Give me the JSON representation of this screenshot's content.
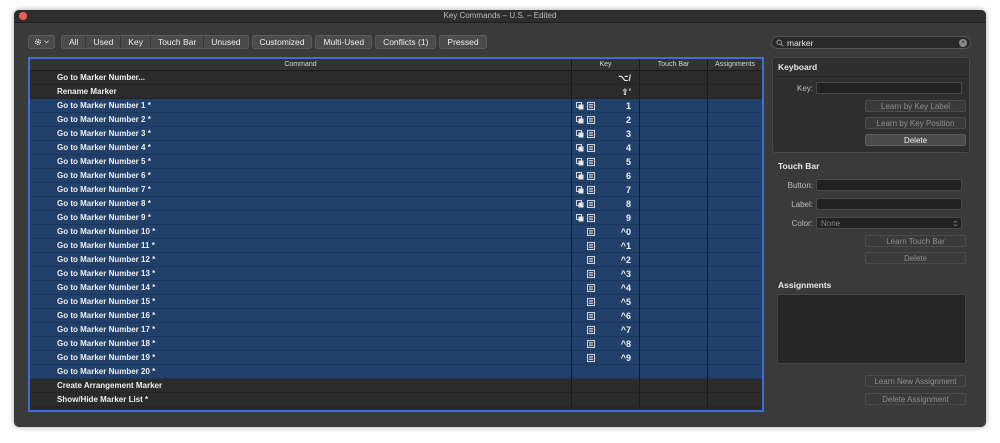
{
  "window": {
    "title": "Key Commands – U.S. – Edited"
  },
  "toolbar": {
    "filters": [
      "All",
      "Used",
      "Key",
      "Touch Bar",
      "Unused"
    ],
    "customized": "Customized",
    "multi_used": "Multi-Used",
    "conflicts": "Conflicts (1)",
    "pressed": "Pressed"
  },
  "search": {
    "value": "marker"
  },
  "table": {
    "headers": {
      "command": "Command",
      "key": "Key",
      "touch_bar": "Touch Bar",
      "assignments": "Assignments"
    },
    "rows": [
      {
        "command": "Go to Marker Number...",
        "key": "⌥/",
        "icons": false,
        "selected": false
      },
      {
        "command": "Rename Marker",
        "key": "⇧'",
        "icons": false,
        "selected": false
      },
      {
        "command": "Go to Marker Number 1 *",
        "key": "1",
        "icons": true,
        "selected": true
      },
      {
        "command": "Go to Marker Number 2 *",
        "key": "2",
        "icons": true,
        "selected": true
      },
      {
        "command": "Go to Marker Number 3 *",
        "key": "3",
        "icons": true,
        "selected": true
      },
      {
        "command": "Go to Marker Number 4 *",
        "key": "4",
        "icons": true,
        "selected": true
      },
      {
        "command": "Go to Marker Number 5 *",
        "key": "5",
        "icons": true,
        "selected": true
      },
      {
        "command": "Go to Marker Number 6 *",
        "key": "6",
        "icons": true,
        "selected": true
      },
      {
        "command": "Go to Marker Number 7 *",
        "key": "7",
        "icons": true,
        "selected": true
      },
      {
        "command": "Go to Marker Number 8 *",
        "key": "8",
        "icons": true,
        "selected": true
      },
      {
        "command": "Go to Marker Number 9 *",
        "key": "9",
        "icons": true,
        "selected": true
      },
      {
        "command": "Go to Marker Number 10 *",
        "key": "^0",
        "icons": "single",
        "selected": true
      },
      {
        "command": "Go to Marker Number 11 *",
        "key": "^1",
        "icons": "single",
        "selected": true
      },
      {
        "command": "Go to Marker Number 12 *",
        "key": "^2",
        "icons": "single",
        "selected": true
      },
      {
        "command": "Go to Marker Number 13 *",
        "key": "^3",
        "icons": "single",
        "selected": true
      },
      {
        "command": "Go to Marker Number 14 *",
        "key": "^4",
        "icons": "single",
        "selected": true
      },
      {
        "command": "Go to Marker Number 15 *",
        "key": "^5",
        "icons": "single",
        "selected": true
      },
      {
        "command": "Go to Marker Number 16 *",
        "key": "^6",
        "icons": "single",
        "selected": true
      },
      {
        "command": "Go to Marker Number 17 *",
        "key": "^7",
        "icons": "single",
        "selected": true
      },
      {
        "command": "Go to Marker Number 18 *",
        "key": "^8",
        "icons": "single",
        "selected": true
      },
      {
        "command": "Go to Marker Number 19 *",
        "key": "^9",
        "icons": "single",
        "selected": true
      },
      {
        "command": "Go to Marker Number 20 *",
        "key": "",
        "icons": false,
        "selected": true
      },
      {
        "command": "Create Arrangement Marker",
        "key": "",
        "icons": false,
        "selected": false
      },
      {
        "command": "Show/Hide Marker List *",
        "key": "",
        "icons": false,
        "selected": false
      }
    ]
  },
  "keyboard": {
    "title": "Keyboard",
    "key_label": "Key:",
    "learn_by_label": "Learn by Key Label",
    "learn_by_position": "Learn by Key Position",
    "delete": "Delete"
  },
  "touch_bar": {
    "title": "Touch Bar",
    "button_label": "Button:",
    "label_label": "Label:",
    "color_label": "Color:",
    "color_value": "None",
    "learn": "Learn Touch Bar",
    "delete": "Delete"
  },
  "assignments": {
    "title": "Assignments",
    "learn_new": "Learn New Assignment",
    "delete": "Delete Assignment"
  }
}
